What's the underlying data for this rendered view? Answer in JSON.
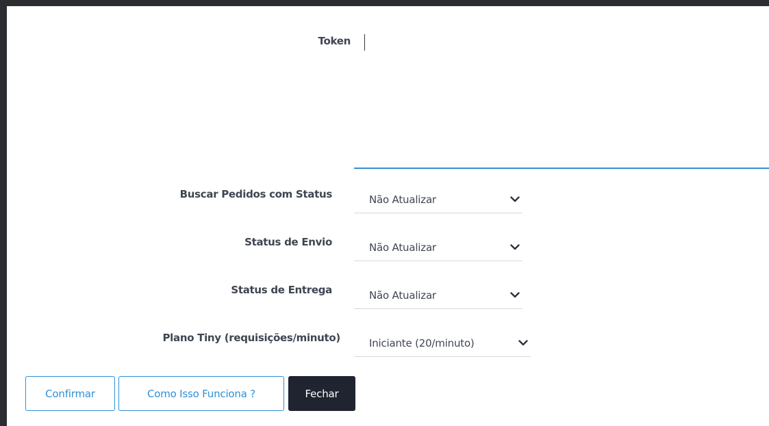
{
  "form": {
    "token": {
      "label": "Token",
      "value": ""
    },
    "fields": [
      {
        "label": "Buscar Pedidos com Status",
        "value": "Não Atualizar"
      },
      {
        "label": "Status de Envio",
        "value": "Não Atualizar"
      },
      {
        "label": "Status de Entrega",
        "value": "Não Atualizar"
      },
      {
        "label": "Plano Tiny (requisições/minuto)",
        "value": "Iniciante (20/minuto)"
      }
    ]
  },
  "actions": {
    "confirm_label": "Confirmar",
    "how_it_works_label": "Como Isso Funciona ?",
    "close_label": "Fechar"
  },
  "colors": {
    "accent": "#2f8fd6",
    "dark_button": "#1f2430",
    "backdrop": "#2b2d31"
  },
  "icons": {
    "dropdown": "chevron-down-icon"
  }
}
